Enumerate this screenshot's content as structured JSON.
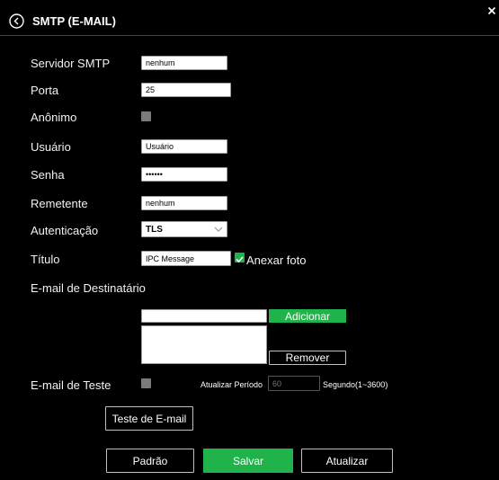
{
  "header": {
    "title": "SMTP (E-MAIL)",
    "back_icon": "back-circle-icon",
    "close_icon": "close-icon"
  },
  "form": {
    "server_label": "Servidor SMTP",
    "server_value": "nenhum",
    "port_label": "Porta",
    "port_value": "25",
    "anonymous_label": "Anônimo",
    "anonymous_checked": false,
    "user_label": "Usuário",
    "user_value": "Usuário",
    "password_label": "Senha",
    "password_value": "••••••",
    "sender_label": "Remetente",
    "sender_value": "nenhum",
    "auth_label": "Autenticação",
    "auth_value": "TLS",
    "title_label": "Título",
    "title_value": "IPC Message",
    "attach_label": "Anexar foto",
    "attach_checked": true,
    "recipient_label": "E-mail de Destinatário",
    "recipient_input_value": "",
    "add_label": "Adicionar",
    "remove_label": "Remover",
    "test_email_label": "E-mail de Teste",
    "test_email_checked": false,
    "update_period_label": "Atualizar Período",
    "update_period_placeholder": "60",
    "update_period_unit": "Segundo(1~3600)",
    "test_button_label": "Teste de E-mail"
  },
  "footer": {
    "default_label": "Padrão",
    "save_label": "Salvar",
    "refresh_label": "Atualizar"
  },
  "colors": {
    "accent": "#1fb34a",
    "background": "#000000",
    "checkbox": "#7b7b7b"
  }
}
